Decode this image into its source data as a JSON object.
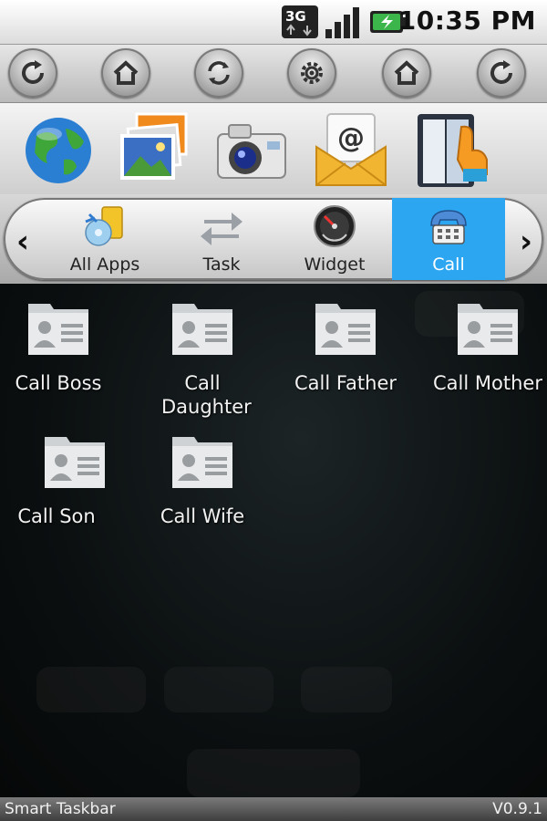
{
  "status_bar": {
    "time": "10:35 PM",
    "network": "3G"
  },
  "quick_buttons": [
    {
      "icon": "rotate-icon"
    },
    {
      "icon": "home-icon"
    },
    {
      "icon": "sync-icon"
    },
    {
      "icon": "settings-icon"
    },
    {
      "icon": "home-icon"
    },
    {
      "icon": "rotate-icon"
    }
  ],
  "shortcuts": [
    {
      "icon": "globe-icon"
    },
    {
      "icon": "gallery-icon"
    },
    {
      "icon": "camera-icon"
    },
    {
      "icon": "email-icon"
    },
    {
      "icon": "dialer-icon"
    }
  ],
  "tabs": [
    {
      "label": "All Apps",
      "icon": "all-apps-icon",
      "active": false
    },
    {
      "label": "Task",
      "icon": "task-icon",
      "active": false
    },
    {
      "label": "Widget",
      "icon": "widget-icon",
      "active": false
    },
    {
      "label": "Call",
      "icon": "phone-icon",
      "active": true
    }
  ],
  "apps": [
    {
      "name": "Call Boss"
    },
    {
      "name": "Call Daughter"
    },
    {
      "name": "Call Father"
    },
    {
      "name": "Call Mother"
    },
    {
      "name": "Call Son"
    },
    {
      "name": "Call Wife"
    }
  ],
  "footer": {
    "app_name": "Smart Taskbar",
    "version": "V0.9.1"
  },
  "colors": {
    "active_tab": "#2da6f2"
  }
}
